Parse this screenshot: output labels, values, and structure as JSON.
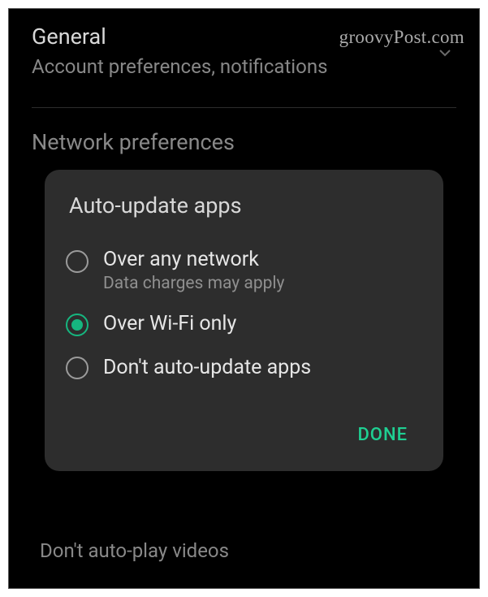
{
  "watermark": "groovyPost.com",
  "settings": {
    "general": {
      "title": "General",
      "subtitle": "Account preferences, notifications"
    },
    "network": {
      "title": "Network preferences"
    },
    "autoplay_hint": "Don't auto-play videos"
  },
  "dialog": {
    "title": "Auto-update apps",
    "options": [
      {
        "label": "Over any network",
        "sub": "Data charges may apply",
        "selected": false
      },
      {
        "label": "Over Wi-Fi only",
        "sub": "",
        "selected": true
      },
      {
        "label": "Don't auto-update apps",
        "sub": "",
        "selected": false
      }
    ],
    "done": "DONE"
  }
}
